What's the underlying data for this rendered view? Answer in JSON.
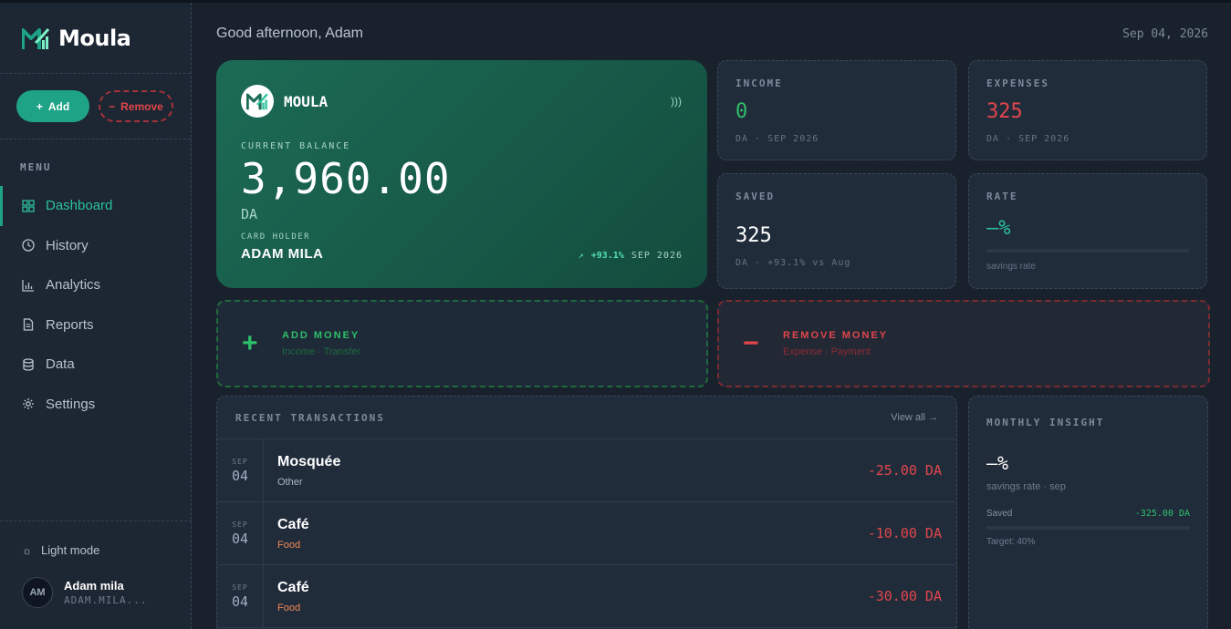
{
  "brand": {
    "name": "Moula"
  },
  "sidebar": {
    "add_label": "Add",
    "remove_label": "Remove",
    "menu_label": "MENU",
    "items": [
      {
        "label": "Dashboard",
        "icon": "grid-icon"
      },
      {
        "label": "History",
        "icon": "clock-icon"
      },
      {
        "label": "Analytics",
        "icon": "bar-chart-icon"
      },
      {
        "label": "Reports",
        "icon": "document-icon"
      },
      {
        "label": "Data",
        "icon": "database-icon"
      },
      {
        "label": "Settings",
        "icon": "gear-icon"
      }
    ],
    "theme_label": "Light mode",
    "user": {
      "name": "Adam mila",
      "email": "ADAM.MILA...",
      "initials": "AM"
    }
  },
  "header": {
    "greeting": "Good afternoon, Adam",
    "date": "Sep 04, 2026"
  },
  "card": {
    "brand": "MOULA",
    "balance_label": "CURRENT BALANCE",
    "balance": "3,960.00",
    "currency": "DA",
    "holder_label": "CARD HOLDER",
    "holder": "ADAM MILA",
    "trend": "+93.1%",
    "trend_period": "SEP 2026"
  },
  "stats": {
    "income": {
      "label": "INCOME",
      "value": "0",
      "sub": "DA · SEP 2026",
      "color": "#2ebf6a"
    },
    "expenses": {
      "label": "EXPENSES",
      "value": "325",
      "sub": "DA · SEP 2026",
      "color": "#e0464b"
    },
    "saved": {
      "label": "SAVED",
      "value": "325",
      "sub": "DA · +93.1% vs Aug",
      "color": "#ffffff"
    },
    "rate": {
      "label": "RATE",
      "value": "—%",
      "sub": "savings rate",
      "color": "#2bc29d"
    }
  },
  "ops": {
    "add": {
      "title": "ADD MONEY",
      "sub": "Income · Transfer",
      "sign": "+"
    },
    "remove": {
      "title": "REMOVE MONEY",
      "sub": "Expense · Payment",
      "sign": "−"
    }
  },
  "transactions": {
    "title": "RECENT TRANSACTIONS",
    "view_all": "View all →",
    "rows": [
      {
        "mon": "SEP",
        "day": "04",
        "name": "Mosquée",
        "cat": "Other",
        "cat_color": "#a9b4c2",
        "amount": "-25.00 DA"
      },
      {
        "mon": "SEP",
        "day": "04",
        "name": "Café",
        "cat": "Food",
        "cat_color": "#f28a58",
        "amount": "-10.00 DA"
      },
      {
        "mon": "SEP",
        "day": "04",
        "name": "Café",
        "cat": "Food",
        "cat_color": "#f28a58",
        "amount": "-30.00 DA"
      }
    ]
  },
  "insight": {
    "title": "MONTHLY INSIGHT",
    "rate": "—%",
    "sub": "savings rate · sep",
    "saved_label": "Saved",
    "saved_value": "-325.00 DA",
    "target": "Target: 40%"
  },
  "colors": {
    "accent": "#1fa386",
    "danger": "#e0464b",
    "success": "#2ebf6a"
  }
}
